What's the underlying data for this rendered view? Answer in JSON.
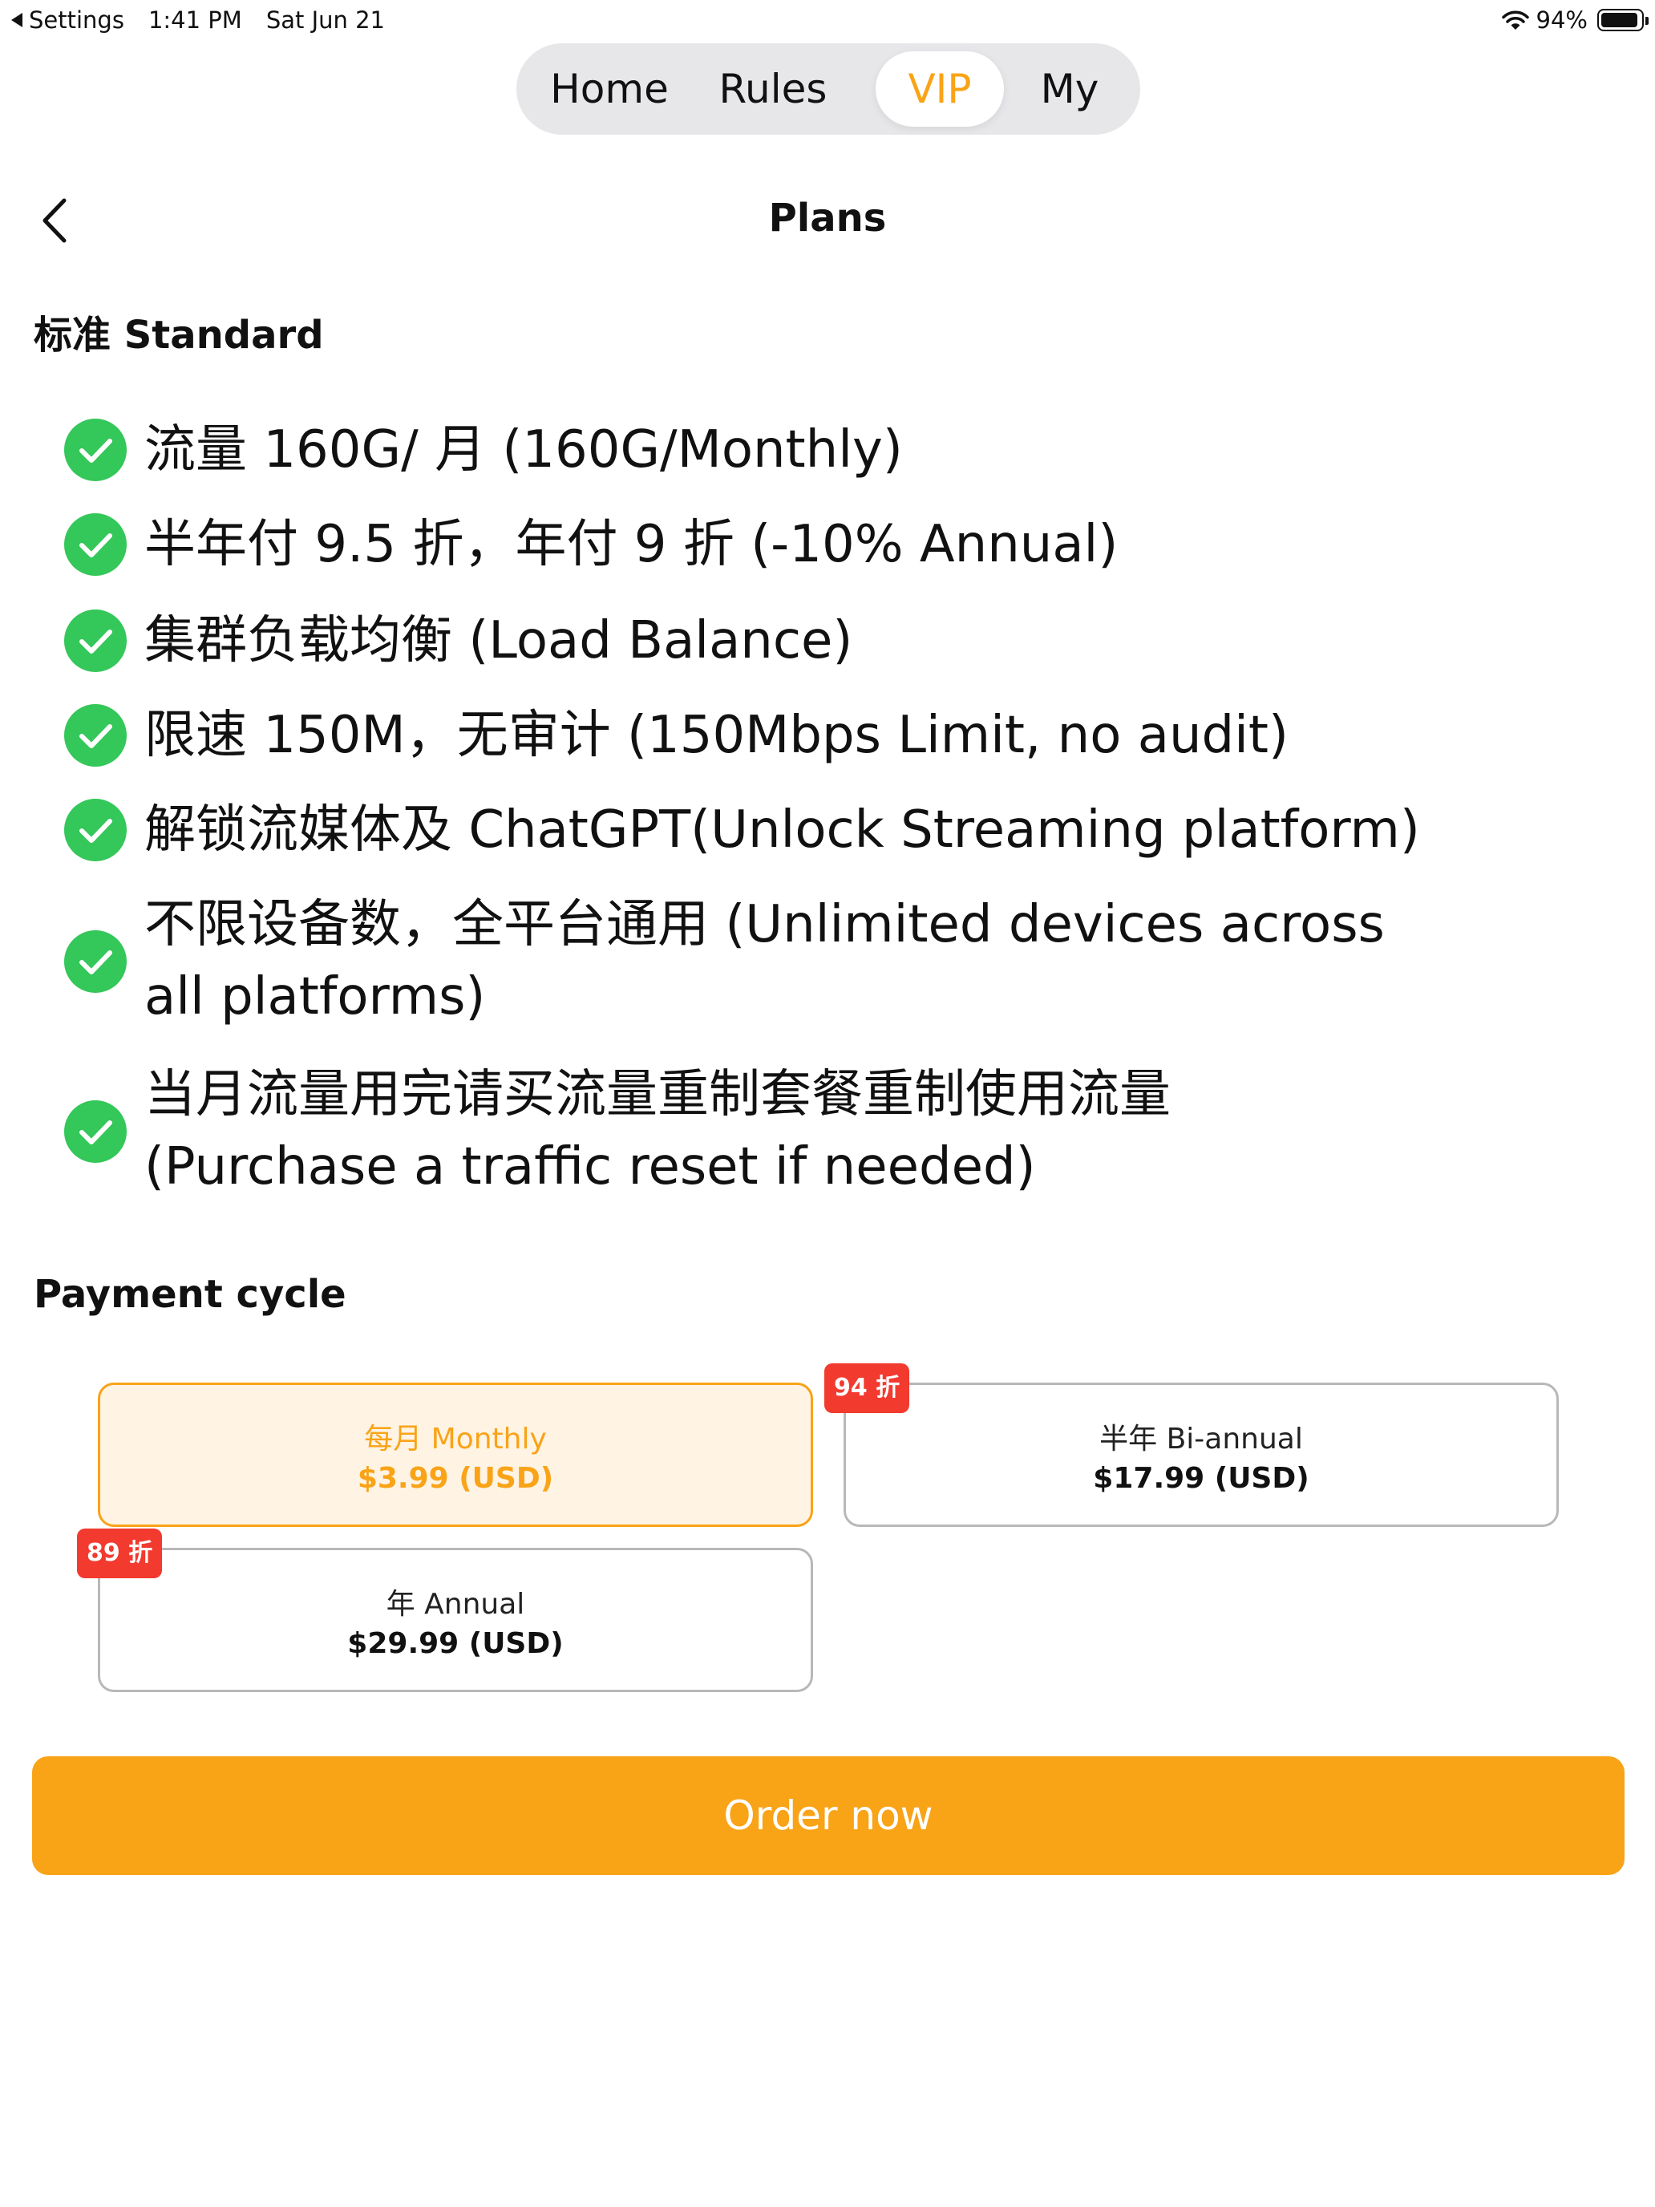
{
  "status_bar": {
    "back_app": "Settings",
    "time": "1:41 PM",
    "date": "Sat Jun 21",
    "battery": "94%",
    "battery_level": 0.94
  },
  "tabs": [
    {
      "label": "Home",
      "selected": false
    },
    {
      "label": "Rules",
      "selected": false
    },
    {
      "label": "VIP",
      "selected": true
    },
    {
      "label": "My",
      "selected": false
    }
  ],
  "header": {
    "title": "Plans"
  },
  "plan": {
    "name": "标准 Standard",
    "features": [
      {
        "lines": [
          "流量 160G/ 月 (160G/Monthly)"
        ]
      },
      {
        "lines": [
          "半年付 9.5 折，年付 9 折 (-10% Annual)"
        ]
      },
      {
        "lines": [
          "集群负载均衡 (Load Balance)"
        ]
      },
      {
        "lines": [
          "限速 150M，无审计 (150Mbps Limit, no audit)"
        ]
      },
      {
        "lines": [
          "解锁流媒体及 ChatGPT(Unlock Streaming platform)"
        ]
      },
      {
        "lines": [
          "不限设备数，全平台通用 (Unlimited devices across",
          "all platforms)"
        ]
      },
      {
        "lines": [
          "当月流量用完请买流量重制套餐重制使用流量",
          " (Purchase a traffic reset if needed)"
        ]
      }
    ]
  },
  "payment": {
    "title": "Payment cycle",
    "options": [
      {
        "label": "每月 Monthly",
        "price": "$3.99 (USD)",
        "badge": "",
        "selected": true
      },
      {
        "label": "半年 Bi-annual",
        "price": "$17.99 (USD)",
        "badge": "94 折",
        "selected": false
      },
      {
        "label": "年 Annual",
        "price": "$29.99 (USD)",
        "badge": "89 折",
        "selected": false
      }
    ]
  },
  "order_button": "Order now",
  "colors": {
    "accent": "#f9a317",
    "check": "#34c759",
    "badge": "#f23a2f"
  }
}
